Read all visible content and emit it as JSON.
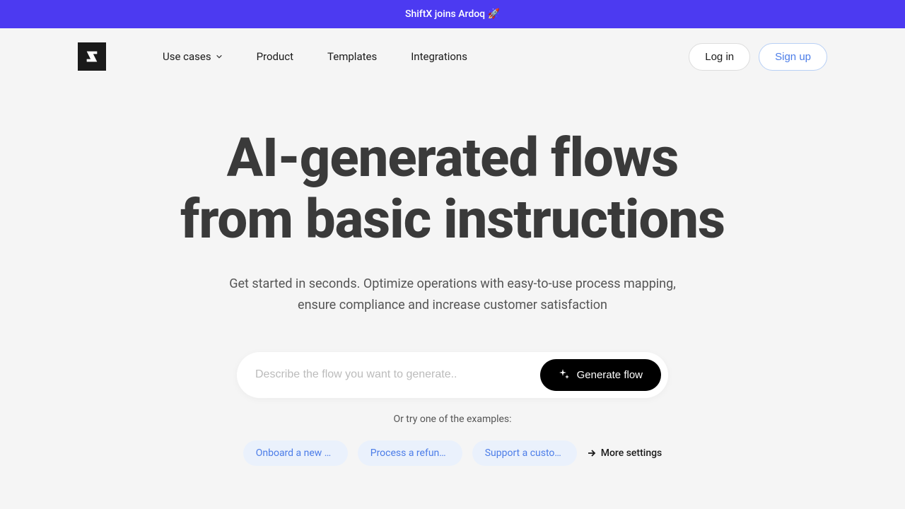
{
  "banner": {
    "text": "ShiftX joins Ardoq 🚀"
  },
  "nav": {
    "use_cases": "Use cases",
    "product": "Product",
    "templates": "Templates",
    "integrations": "Integrations",
    "login": "Log in",
    "signup": "Sign up"
  },
  "hero": {
    "title_line1": "AI-generated flows",
    "title_line2": "from basic instructions",
    "subtitle": "Get started in seconds. Optimize operations with easy-to-use process mapping, ensure compliance and increase customer satisfaction"
  },
  "generator": {
    "placeholder": "Describe the flow you want to generate..",
    "button": "Generate flow"
  },
  "examples": {
    "label": "Or try one of the examples:",
    "items": [
      "Onboard a new user to a digital banking app",
      "Process a refund for an online order",
      "Support a customer with a billing issue"
    ],
    "more": "More settings"
  }
}
